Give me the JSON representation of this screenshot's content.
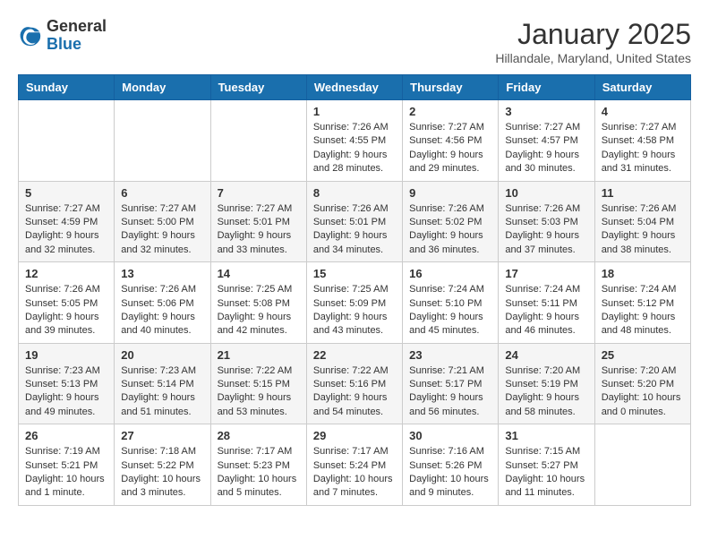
{
  "logo": {
    "general": "General",
    "blue": "Blue"
  },
  "header": {
    "title": "January 2025",
    "location": "Hillandale, Maryland, United States"
  },
  "weekdays": [
    "Sunday",
    "Monday",
    "Tuesday",
    "Wednesday",
    "Thursday",
    "Friday",
    "Saturday"
  ],
  "weeks": [
    [
      {
        "day": "",
        "info": ""
      },
      {
        "day": "",
        "info": ""
      },
      {
        "day": "",
        "info": ""
      },
      {
        "day": "1",
        "info": "Sunrise: 7:26 AM\nSunset: 4:55 PM\nDaylight: 9 hours\nand 28 minutes."
      },
      {
        "day": "2",
        "info": "Sunrise: 7:27 AM\nSunset: 4:56 PM\nDaylight: 9 hours\nand 29 minutes."
      },
      {
        "day": "3",
        "info": "Sunrise: 7:27 AM\nSunset: 4:57 PM\nDaylight: 9 hours\nand 30 minutes."
      },
      {
        "day": "4",
        "info": "Sunrise: 7:27 AM\nSunset: 4:58 PM\nDaylight: 9 hours\nand 31 minutes."
      }
    ],
    [
      {
        "day": "5",
        "info": "Sunrise: 7:27 AM\nSunset: 4:59 PM\nDaylight: 9 hours\nand 32 minutes."
      },
      {
        "day": "6",
        "info": "Sunrise: 7:27 AM\nSunset: 5:00 PM\nDaylight: 9 hours\nand 32 minutes."
      },
      {
        "day": "7",
        "info": "Sunrise: 7:27 AM\nSunset: 5:01 PM\nDaylight: 9 hours\nand 33 minutes."
      },
      {
        "day": "8",
        "info": "Sunrise: 7:26 AM\nSunset: 5:01 PM\nDaylight: 9 hours\nand 34 minutes."
      },
      {
        "day": "9",
        "info": "Sunrise: 7:26 AM\nSunset: 5:02 PM\nDaylight: 9 hours\nand 36 minutes."
      },
      {
        "day": "10",
        "info": "Sunrise: 7:26 AM\nSunset: 5:03 PM\nDaylight: 9 hours\nand 37 minutes."
      },
      {
        "day": "11",
        "info": "Sunrise: 7:26 AM\nSunset: 5:04 PM\nDaylight: 9 hours\nand 38 minutes."
      }
    ],
    [
      {
        "day": "12",
        "info": "Sunrise: 7:26 AM\nSunset: 5:05 PM\nDaylight: 9 hours\nand 39 minutes."
      },
      {
        "day": "13",
        "info": "Sunrise: 7:26 AM\nSunset: 5:06 PM\nDaylight: 9 hours\nand 40 minutes."
      },
      {
        "day": "14",
        "info": "Sunrise: 7:25 AM\nSunset: 5:08 PM\nDaylight: 9 hours\nand 42 minutes."
      },
      {
        "day": "15",
        "info": "Sunrise: 7:25 AM\nSunset: 5:09 PM\nDaylight: 9 hours\nand 43 minutes."
      },
      {
        "day": "16",
        "info": "Sunrise: 7:24 AM\nSunset: 5:10 PM\nDaylight: 9 hours\nand 45 minutes."
      },
      {
        "day": "17",
        "info": "Sunrise: 7:24 AM\nSunset: 5:11 PM\nDaylight: 9 hours\nand 46 minutes."
      },
      {
        "day": "18",
        "info": "Sunrise: 7:24 AM\nSunset: 5:12 PM\nDaylight: 9 hours\nand 48 minutes."
      }
    ],
    [
      {
        "day": "19",
        "info": "Sunrise: 7:23 AM\nSunset: 5:13 PM\nDaylight: 9 hours\nand 49 minutes."
      },
      {
        "day": "20",
        "info": "Sunrise: 7:23 AM\nSunset: 5:14 PM\nDaylight: 9 hours\nand 51 minutes."
      },
      {
        "day": "21",
        "info": "Sunrise: 7:22 AM\nSunset: 5:15 PM\nDaylight: 9 hours\nand 53 minutes."
      },
      {
        "day": "22",
        "info": "Sunrise: 7:22 AM\nSunset: 5:16 PM\nDaylight: 9 hours\nand 54 minutes."
      },
      {
        "day": "23",
        "info": "Sunrise: 7:21 AM\nSunset: 5:17 PM\nDaylight: 9 hours\nand 56 minutes."
      },
      {
        "day": "24",
        "info": "Sunrise: 7:20 AM\nSunset: 5:19 PM\nDaylight: 9 hours\nand 58 minutes."
      },
      {
        "day": "25",
        "info": "Sunrise: 7:20 AM\nSunset: 5:20 PM\nDaylight: 10 hours\nand 0 minutes."
      }
    ],
    [
      {
        "day": "26",
        "info": "Sunrise: 7:19 AM\nSunset: 5:21 PM\nDaylight: 10 hours\nand 1 minute."
      },
      {
        "day": "27",
        "info": "Sunrise: 7:18 AM\nSunset: 5:22 PM\nDaylight: 10 hours\nand 3 minutes."
      },
      {
        "day": "28",
        "info": "Sunrise: 7:17 AM\nSunset: 5:23 PM\nDaylight: 10 hours\nand 5 minutes."
      },
      {
        "day": "29",
        "info": "Sunrise: 7:17 AM\nSunset: 5:24 PM\nDaylight: 10 hours\nand 7 minutes."
      },
      {
        "day": "30",
        "info": "Sunrise: 7:16 AM\nSunset: 5:26 PM\nDaylight: 10 hours\nand 9 minutes."
      },
      {
        "day": "31",
        "info": "Sunrise: 7:15 AM\nSunset: 5:27 PM\nDaylight: 10 hours\nand 11 minutes."
      },
      {
        "day": "",
        "info": ""
      }
    ]
  ]
}
